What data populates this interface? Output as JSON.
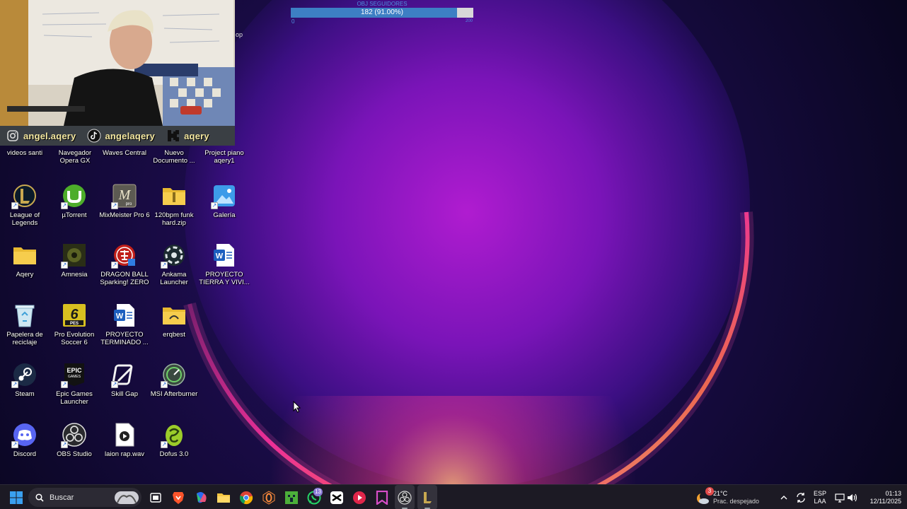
{
  "overlay": {
    "goal_title": "OBJ SEGUIDORES",
    "goal_text": "182 (91.00%)",
    "goal_fraction": 0.91,
    "goal_min": "0",
    "goal_max": "200",
    "stray_text": "op"
  },
  "webcam": {
    "instagram_handle": "angel.aqery",
    "tiktok_handle": "angelaqery",
    "kick_handle": "aqery"
  },
  "desktop": {
    "top_row": [
      {
        "label": "videos santi"
      },
      {
        "label": "Navegador Opera GX"
      },
      {
        "label": "Waves Central"
      },
      {
        "label": "Nuevo Documento ..."
      },
      {
        "label": "Project piano aqery1"
      }
    ],
    "icons": [
      {
        "label": "League of Legends"
      },
      {
        "label": "µTorrent"
      },
      {
        "label": "MixMeister Pro 6"
      },
      {
        "label": "120bpm funk hard.zip"
      },
      {
        "label": "Galería"
      },
      {
        "label": "Aqery"
      },
      {
        "label": "Amnesia"
      },
      {
        "label": "DRAGON BALL Sparking! ZERO"
      },
      {
        "label": "Ankama Launcher"
      },
      {
        "label": "PROYECTO TIERRA Y VIVI..."
      },
      {
        "label": "Papelera de reciclaje"
      },
      {
        "label": "Pro Evolution Soccer 6"
      },
      {
        "label": "PROYECTO TERMINADO ..."
      },
      {
        "label": "erqbest"
      },
      {
        "label": "Steam"
      },
      {
        "label": "Epic Games Launcher"
      },
      {
        "label": "Skill Gap"
      },
      {
        "label": "MSI Afterburner"
      },
      {
        "label": "Discord"
      },
      {
        "label": "OBS Studio"
      },
      {
        "label": "laion rap.wav"
      },
      {
        "label": "Dofus 3.0"
      }
    ],
    "icon_glyphs": {
      "epic": "EPIC",
      "epic_sub": "GAMES",
      "pes": "6",
      "pes_sub": "PES",
      "mixmeister": "M",
      "mixmeister_sub": "pro",
      "word": "W"
    }
  },
  "taskbar": {
    "search_placeholder": "Buscar",
    "whatsapp_badge": "13",
    "weather_badge": "3",
    "weather_temp": "21°C",
    "weather_desc": "Prac. despejado",
    "lang_1": "ESP",
    "lang_2": "LAA",
    "time": "01:13",
    "date": "12/11/2025"
  },
  "colors": {
    "goal_fill": "#3d7fc4",
    "social_text": "#f3e7a0",
    "taskbar_bg": "#1c1a24"
  }
}
